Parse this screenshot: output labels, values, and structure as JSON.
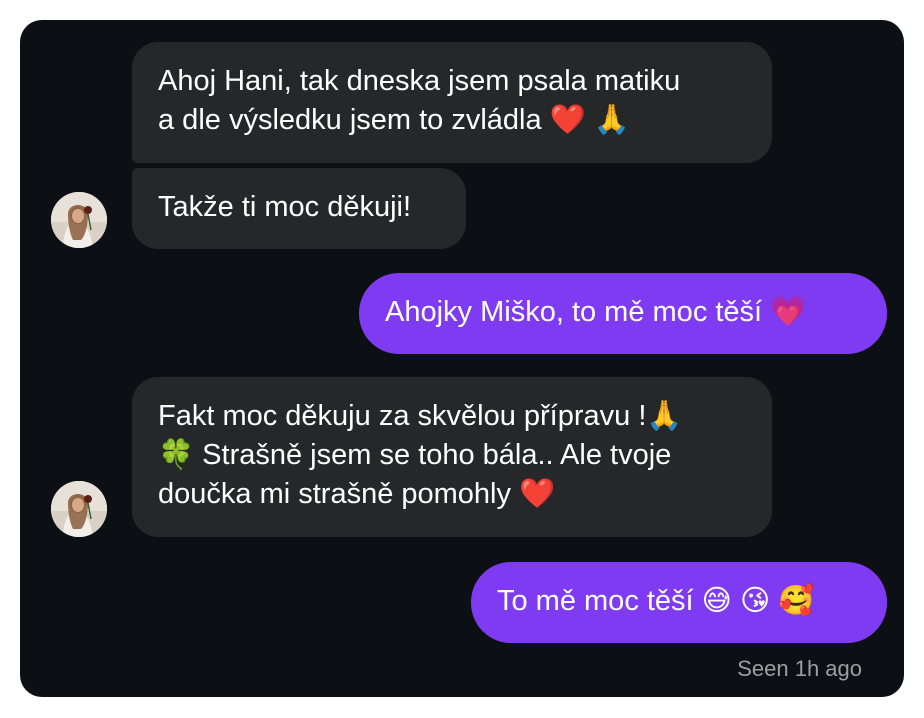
{
  "messages": [
    {
      "lines": [
        "Ahoj Hani, tak dneska jsem psala matiku",
        "a dle výsledku jsem to zvládla ❤️ 🙏"
      ]
    },
    {
      "lines": [
        "Takže ti moc děkuji!"
      ]
    },
    {
      "lines": [
        "Ahojky Miško, to mě moc těší 💗"
      ]
    },
    {
      "lines": [
        "Fakt moc děkuju za skvělou přípravu !🙏",
        "🍀 Strašně jsem se toho bála.. Ale tvoje",
        "doučka mi strašně pomohly ❤️"
      ]
    },
    {
      "lines": [
        "To mě moc těší 😅 😘 🥰"
      ]
    }
  ],
  "status": {
    "seen": "Seen 1h ago"
  },
  "colors": {
    "background": "#0c0f13",
    "incoming_bubble": "#262729",
    "outgoing_bubble": "#7e3bf2",
    "status_text": "#9c9ea2"
  },
  "icons": {
    "avatar": "profile-photo"
  }
}
